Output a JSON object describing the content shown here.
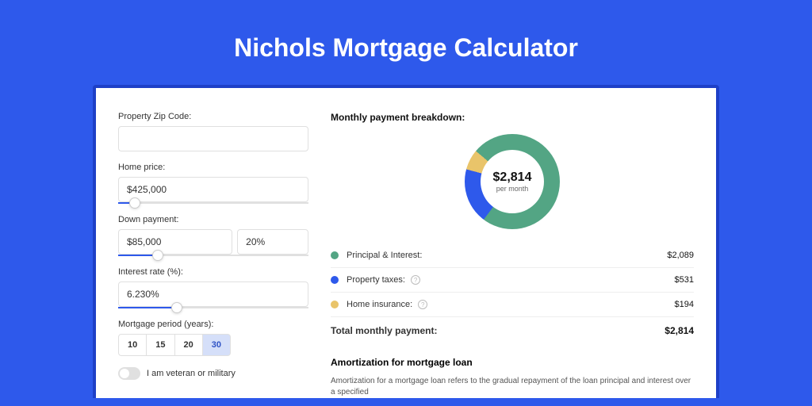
{
  "title": "Nichols Mortgage Calculator",
  "form": {
    "zip_label": "Property Zip Code:",
    "zip_value": "",
    "price_label": "Home price:",
    "price_value": "$425,000",
    "down_label": "Down payment:",
    "down_value": "$85,000",
    "down_pct": "20%",
    "rate_label": "Interest rate (%):",
    "rate_value": "6.230%",
    "period_label": "Mortgage period (years):",
    "periods": {
      "p10": "10",
      "p15": "15",
      "p20": "20",
      "p30": "30"
    },
    "veteran_label": "I am veteran or military"
  },
  "breakdown": {
    "heading": "Monthly payment breakdown:",
    "donut_value": "$2,814",
    "donut_sub": "per month",
    "pi_label": "Principal & Interest:",
    "pi_value": "$2,089",
    "tax_label": "Property taxes:",
    "tax_value": "$531",
    "ins_label": "Home insurance:",
    "ins_value": "$194",
    "total_label": "Total monthly payment:",
    "total_value": "$2,814"
  },
  "amort": {
    "heading": "Amortization for mortgage loan",
    "text": "Amortization for a mortgage loan refers to the gradual repayment of the loan principal and interest over a specified"
  },
  "colors": {
    "pi": "#53a584",
    "tax": "#2e59eb",
    "ins": "#e9c46a"
  },
  "chart_data": {
    "type": "pie",
    "title": "Monthly payment breakdown",
    "series": [
      {
        "name": "Principal & Interest",
        "value": 2089,
        "color": "#53a584"
      },
      {
        "name": "Property taxes",
        "value": 531,
        "color": "#2e59eb"
      },
      {
        "name": "Home insurance",
        "value": 194,
        "color": "#e9c46a"
      }
    ],
    "total": 2814,
    "center_label": "$2,814",
    "center_sublabel": "per month"
  }
}
